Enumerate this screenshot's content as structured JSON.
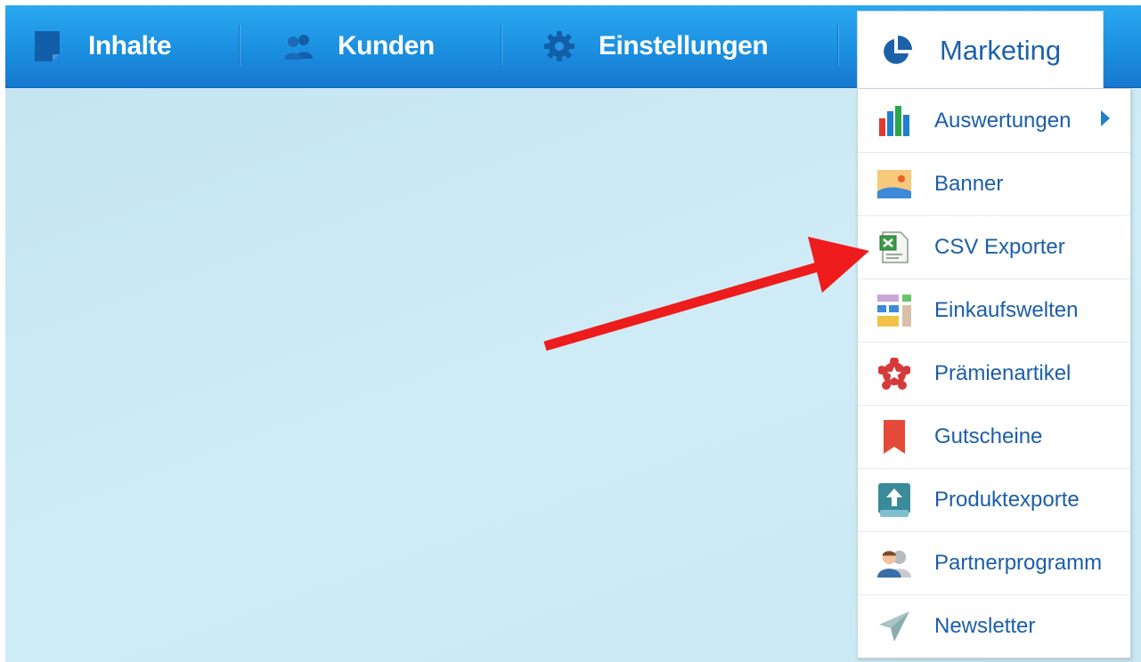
{
  "nav": {
    "items": [
      {
        "label": "Inhalte",
        "icon": "document-icon"
      },
      {
        "label": "Kunden",
        "icon": "users-icon"
      },
      {
        "label": "Einstellungen",
        "icon": "gear-icon"
      }
    ],
    "active": {
      "label": "Marketing",
      "icon": "pie-chart-icon"
    }
  },
  "menu": {
    "items": [
      {
        "label": "Auswertungen",
        "icon": "bar-chart-icon",
        "has_submenu": true
      },
      {
        "label": "Banner",
        "icon": "image-icon"
      },
      {
        "label": "CSV Exporter",
        "icon": "spreadsheet-icon"
      },
      {
        "label": "Einkaufswelten",
        "icon": "layout-grid-icon"
      },
      {
        "label": "Prämienartikel",
        "icon": "star-badge-icon"
      },
      {
        "label": "Gutscheine",
        "icon": "bookmark-icon"
      },
      {
        "label": "Produktexporte",
        "icon": "upload-icon"
      },
      {
        "label": "Partnerprogramm",
        "icon": "partner-icon"
      },
      {
        "label": "Newsletter",
        "icon": "paper-plane-icon"
      }
    ]
  },
  "annotation": {
    "color": "#ee1c1c",
    "target": "CSV Exporter"
  },
  "colors": {
    "nav_blue": "#1b8fe0",
    "menu_text": "#1c5ea8",
    "background": "#c9e8f3"
  }
}
